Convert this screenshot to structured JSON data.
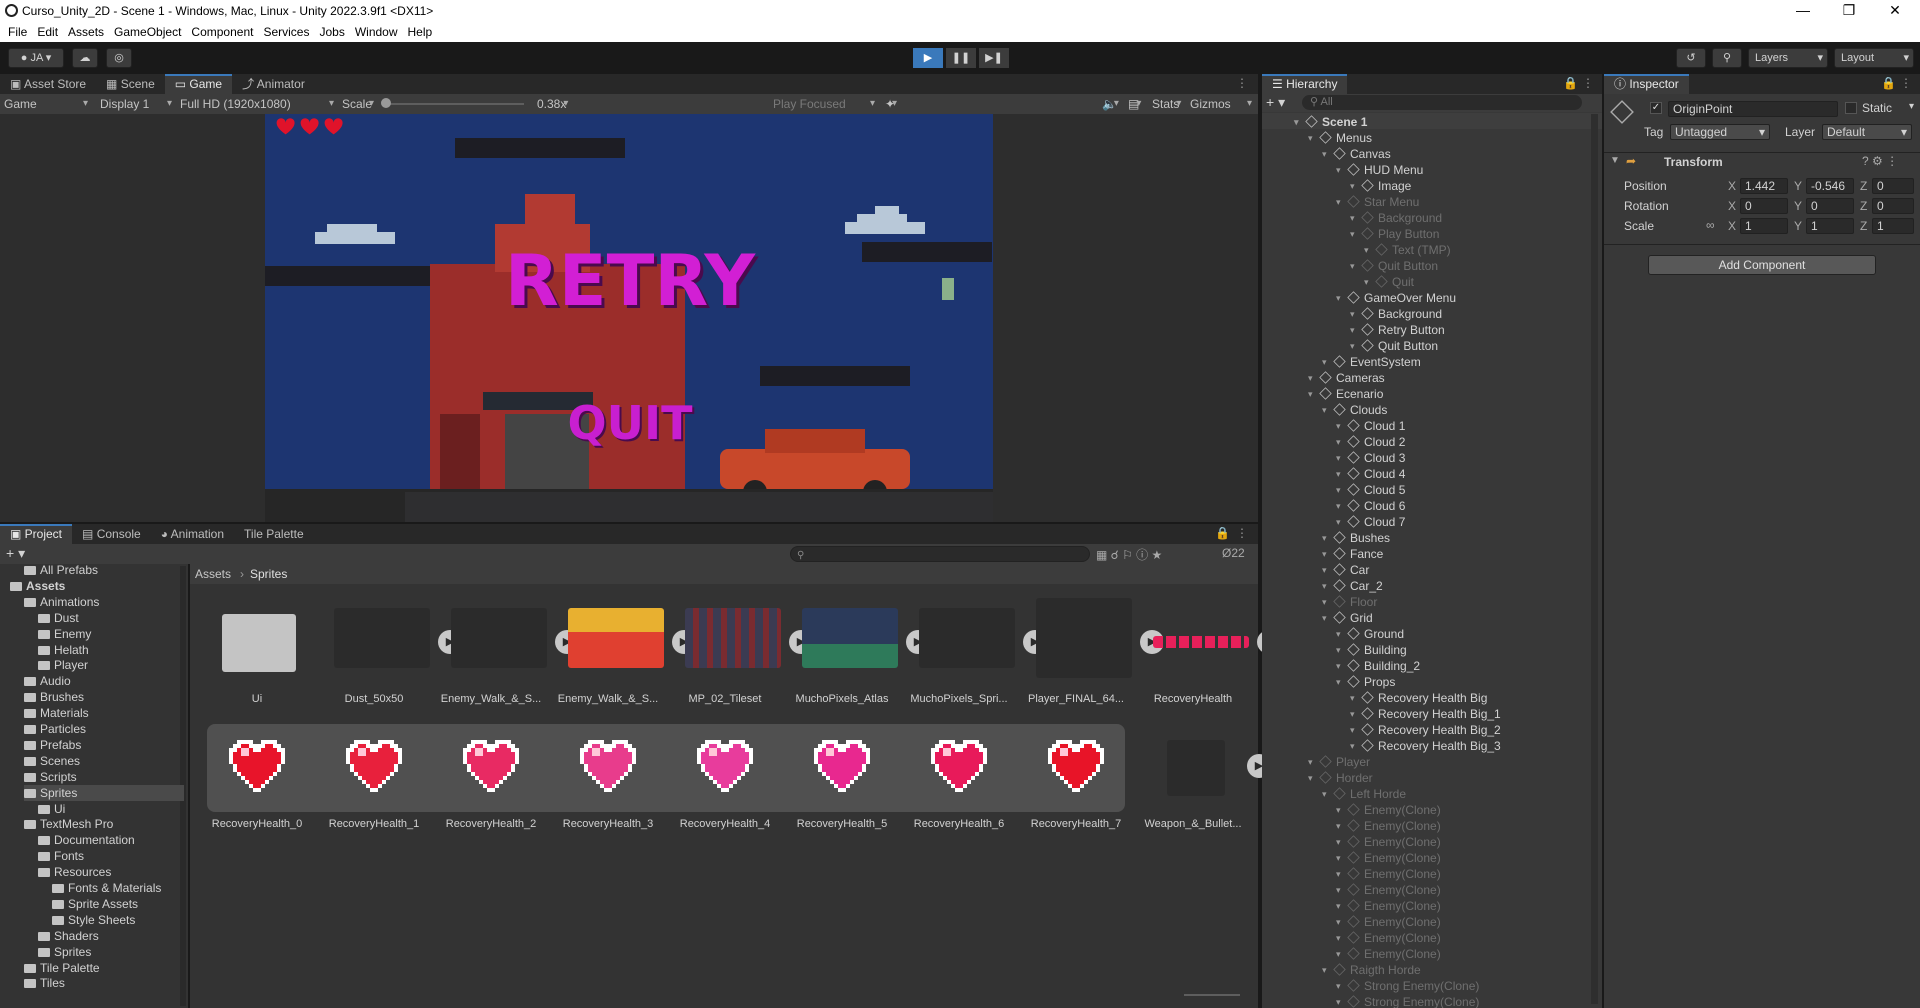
{
  "window": {
    "title": "Curso_Unity_2D - Scene 1 - Windows, Mac, Linux - Unity 2022.3.9f1 <DX11>"
  },
  "menu": [
    "File",
    "Edit",
    "Assets",
    "GameObject",
    "Component",
    "Services",
    "Jobs",
    "Window",
    "Help"
  ],
  "toolbar": {
    "account": "JA",
    "layers": "Layers",
    "layout": "Layout"
  },
  "scene_tabs": [
    "Asset Store",
    "Scene",
    "Game",
    "Animator"
  ],
  "game_bar": {
    "mode": "Game",
    "display": "Display 1",
    "resolution": "Full HD (1920x1080)",
    "scale_label": "Scale",
    "scale_value": "0.38x",
    "play_focused": "Play Focused",
    "stats": "Stats",
    "gizmos": "Gizmos"
  },
  "game_view": {
    "retry": "RETRY",
    "quit": "QUIT",
    "lives": 3
  },
  "bottom_tabs": [
    "Project",
    "Console",
    "Animation",
    "Tile Palette"
  ],
  "project": {
    "hidden_count": "22",
    "breadcrumb": [
      "Assets",
      "Sprites"
    ],
    "tree": [
      {
        "label": "All Prefabs",
        "depth": 1
      },
      {
        "label": "Assets",
        "depth": 0
      },
      {
        "label": "Animations",
        "depth": 1
      },
      {
        "label": "Dust",
        "depth": 2
      },
      {
        "label": "Enemy",
        "depth": 2
      },
      {
        "label": "Helath",
        "depth": 2
      },
      {
        "label": "Player",
        "depth": 2
      },
      {
        "label": "Audio",
        "depth": 1
      },
      {
        "label": "Brushes",
        "depth": 1
      },
      {
        "label": "Materials",
        "depth": 1
      },
      {
        "label": "Particles",
        "depth": 1
      },
      {
        "label": "Prefabs",
        "depth": 1
      },
      {
        "label": "Scenes",
        "depth": 1
      },
      {
        "label": "Scripts",
        "depth": 1
      },
      {
        "label": "Sprites",
        "depth": 1
      },
      {
        "label": "Ui",
        "depth": 2
      },
      {
        "label": "TextMesh Pro",
        "depth": 1
      },
      {
        "label": "Documentation",
        "depth": 2
      },
      {
        "label": "Fonts",
        "depth": 2
      },
      {
        "label": "Resources",
        "depth": 2
      },
      {
        "label": "Fonts & Materials",
        "depth": 3
      },
      {
        "label": "Sprite Assets",
        "depth": 3
      },
      {
        "label": "Style Sheets",
        "depth": 3
      },
      {
        "label": "Shaders",
        "depth": 2
      },
      {
        "label": "Sprites",
        "depth": 2
      },
      {
        "label": "Tile Palette",
        "depth": 1
      },
      {
        "label": "Tiles",
        "depth": 1
      }
    ],
    "assets_row1": [
      "Ui",
      "Dust_50x50",
      "Enemy_Walk_&_S...",
      "Enemy_Walk_&_S...",
      "MP_02_Tileset",
      "MuchoPixels_Atlas",
      "MuchoPixels_Spri...",
      "Player_FINAL_64...",
      "RecoveryHealth"
    ],
    "assets_row2": [
      "RecoveryHealth_0",
      "RecoveryHealth_1",
      "RecoveryHealth_2",
      "RecoveryHealth_3",
      "RecoveryHealth_4",
      "RecoveryHealth_5",
      "RecoveryHealth_6",
      "RecoveryHealth_7",
      "Weapon_&_Bullet..."
    ],
    "heart_colors": [
      "#e8142a",
      "#e8203c",
      "#e82a63",
      "#e83c8c",
      "#e83c9c",
      "#e8288f",
      "#e81a5a",
      "#e81428"
    ]
  },
  "hierarchy": {
    "title": "Hierarchy",
    "search_placeholder": "All",
    "rows": [
      {
        "label": "Scene 1",
        "depth": 0,
        "dim": false
      },
      {
        "label": "Menus",
        "depth": 1,
        "dim": false
      },
      {
        "label": "Canvas",
        "depth": 2,
        "dim": false
      },
      {
        "label": "HUD Menu",
        "depth": 3,
        "dim": false
      },
      {
        "label": "Image",
        "depth": 4,
        "dim": false
      },
      {
        "label": "Star Menu",
        "depth": 3,
        "dim": true
      },
      {
        "label": "Background",
        "depth": 4,
        "dim": true
      },
      {
        "label": "Play Button",
        "depth": 4,
        "dim": true
      },
      {
        "label": "Text (TMP)",
        "depth": 5,
        "dim": true
      },
      {
        "label": "Quit Button",
        "depth": 4,
        "dim": true
      },
      {
        "label": "Quit",
        "depth": 5,
        "dim": true
      },
      {
        "label": "GameOver Menu",
        "depth": 3,
        "dim": false
      },
      {
        "label": "Background",
        "depth": 4,
        "dim": false
      },
      {
        "label": "Retry Button",
        "depth": 4,
        "dim": false
      },
      {
        "label": "Quit Button",
        "depth": 4,
        "dim": false
      },
      {
        "label": "EventSystem",
        "depth": 2,
        "dim": false
      },
      {
        "label": "Cameras",
        "depth": 1,
        "dim": false
      },
      {
        "label": "Ecenario",
        "depth": 1,
        "dim": false
      },
      {
        "label": "Clouds",
        "depth": 2,
        "dim": false
      },
      {
        "label": "Cloud 1",
        "depth": 3,
        "dim": false
      },
      {
        "label": "Cloud 2",
        "depth": 3,
        "dim": false
      },
      {
        "label": "Cloud 3",
        "depth": 3,
        "dim": false
      },
      {
        "label": "Cloud 4",
        "depth": 3,
        "dim": false
      },
      {
        "label": "Cloud 5",
        "depth": 3,
        "dim": false
      },
      {
        "label": "Cloud 6",
        "depth": 3,
        "dim": false
      },
      {
        "label": "Cloud 7",
        "depth": 3,
        "dim": false
      },
      {
        "label": "Bushes",
        "depth": 2,
        "dim": false
      },
      {
        "label": "Fance",
        "depth": 2,
        "dim": false
      },
      {
        "label": "Car",
        "depth": 2,
        "dim": false
      },
      {
        "label": "Car_2",
        "depth": 2,
        "dim": false
      },
      {
        "label": "Floor",
        "depth": 2,
        "dim": true
      },
      {
        "label": "Grid",
        "depth": 2,
        "dim": false
      },
      {
        "label": "Ground",
        "depth": 3,
        "dim": false
      },
      {
        "label": "Building",
        "depth": 3,
        "dim": false
      },
      {
        "label": "Building_2",
        "depth": 3,
        "dim": false
      },
      {
        "label": "Props",
        "depth": 3,
        "dim": false
      },
      {
        "label": "Recovery Health Big",
        "depth": 4,
        "dim": false
      },
      {
        "label": "Recovery Health Big_1",
        "depth": 4,
        "dim": false
      },
      {
        "label": "Recovery Health Big_2",
        "depth": 4,
        "dim": false
      },
      {
        "label": "Recovery Health Big_3",
        "depth": 4,
        "dim": false
      },
      {
        "label": "Player",
        "depth": 1,
        "dim": true
      },
      {
        "label": "Horder",
        "depth": 1,
        "dim": true
      },
      {
        "label": "Left Horde",
        "depth": 2,
        "dim": true
      },
      {
        "label": "Enemy(Clone)",
        "depth": 3,
        "dim": true
      },
      {
        "label": "Enemy(Clone)",
        "depth": 3,
        "dim": true
      },
      {
        "label": "Enemy(Clone)",
        "depth": 3,
        "dim": true
      },
      {
        "label": "Enemy(Clone)",
        "depth": 3,
        "dim": true
      },
      {
        "label": "Enemy(Clone)",
        "depth": 3,
        "dim": true
      },
      {
        "label": "Enemy(Clone)",
        "depth": 3,
        "dim": true
      },
      {
        "label": "Enemy(Clone)",
        "depth": 3,
        "dim": true
      },
      {
        "label": "Enemy(Clone)",
        "depth": 3,
        "dim": true
      },
      {
        "label": "Enemy(Clone)",
        "depth": 3,
        "dim": true
      },
      {
        "label": "Enemy(Clone)",
        "depth": 3,
        "dim": true
      },
      {
        "label": "Raigth Horde",
        "depth": 2,
        "dim": true
      },
      {
        "label": "Strong Enemy(Clone)",
        "depth": 3,
        "dim": true
      },
      {
        "label": "Strong Enemy(Clone)",
        "depth": 3,
        "dim": true
      }
    ]
  },
  "inspector": {
    "title": "Inspector",
    "object_name": "OriginPoint",
    "static_label": "Static",
    "tag_label": "Tag",
    "tag_value": "Untagged",
    "layer_label": "Layer",
    "layer_value": "Default",
    "component": "Transform",
    "position_label": "Position",
    "position": {
      "x": "1.442",
      "y": "-0.546",
      "z": "0"
    },
    "rotation_label": "Rotation",
    "rotation": {
      "x": "0",
      "y": "0",
      "z": "0"
    },
    "scale_label": "Scale",
    "scale": {
      "x": "1",
      "y": "1",
      "z": "1"
    },
    "add_component": "Add Component"
  },
  "colors": {
    "accent": "#3a79bb",
    "retry": "#d21fd4",
    "quit": "#c81fd0",
    "game_bg": "#1f3a7a"
  }
}
